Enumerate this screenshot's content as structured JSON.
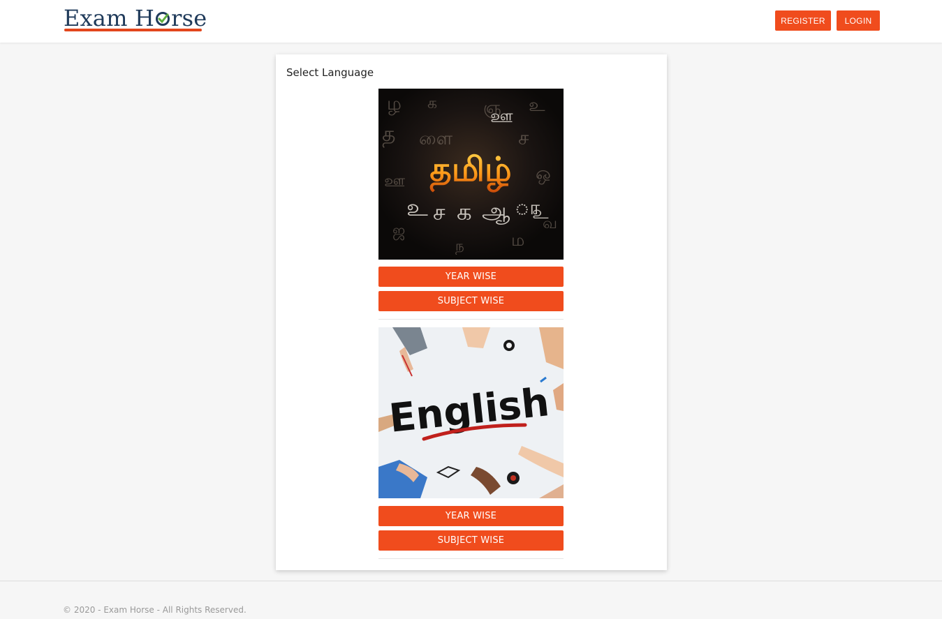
{
  "header": {
    "logo_text_part1": "Exam H",
    "logo_text_part2": "rse",
    "register_label": "REGISTER",
    "login_label": "LOGIN"
  },
  "card": {
    "title": "Select Language",
    "languages": [
      {
        "image_text": "தமிழ்",
        "year_wise_label": "YEAR WISE",
        "subject_wise_label": "SUBJECT WISE"
      },
      {
        "image_text": "English",
        "year_wise_label": "YEAR WISE",
        "subject_wise_label": "SUBJECT WISE"
      }
    ]
  },
  "footer": {
    "copyright": "© 2020 - Exam Horse - All Rights Reserved."
  },
  "colors": {
    "accent": "#f04c1d",
    "logo_navy": "#1f3a5a",
    "logo_check": "#5fae3e"
  }
}
